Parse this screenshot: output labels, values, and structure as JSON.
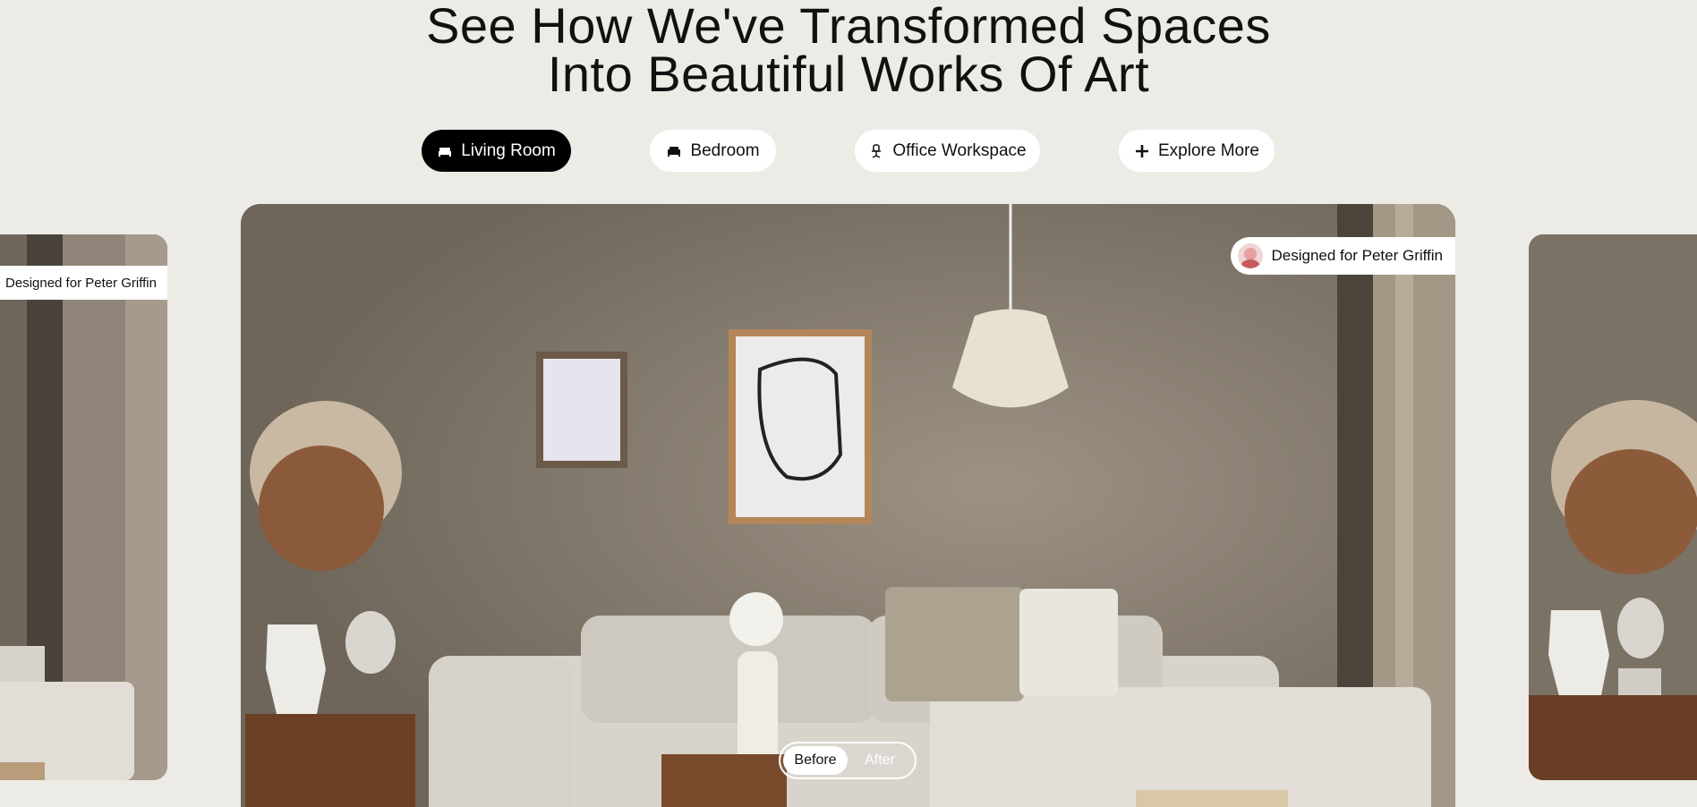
{
  "headline": {
    "line1": "See How We've Transformed Spaces",
    "line2": "Into Beautiful Works Of Art"
  },
  "tabs": [
    {
      "label": "Living Room",
      "icon": "bed-icon",
      "active": true
    },
    {
      "label": "Bedroom",
      "icon": "sofa-icon",
      "active": false
    },
    {
      "label": "Office Workspace",
      "icon": "office-chair-icon",
      "active": false
    },
    {
      "label": "Explore More",
      "icon": "plus-icon",
      "active": false
    }
  ],
  "carousel": {
    "main_badge": "Designed for Peter Griffin",
    "left_badge": "Designed for Peter Griffin"
  },
  "toggle": {
    "before_label": "Before",
    "after_label": "After",
    "selected": "Before"
  },
  "colors": {
    "background": "#ecebe6",
    "active_tab": "#000000",
    "wall": "#7d7468"
  }
}
